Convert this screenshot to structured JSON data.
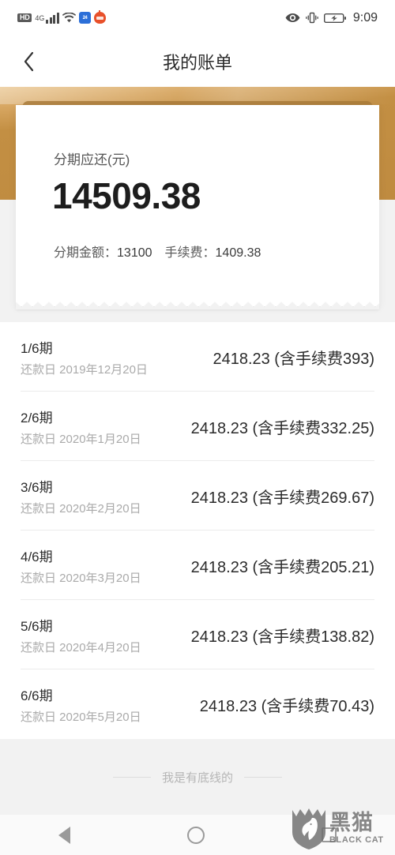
{
  "statusbar": {
    "hd_label": "HD",
    "network_label": "4G",
    "app_icon_blue_text": "24",
    "icons": [
      "hd-icon",
      "signal-icon",
      "wifi-icon",
      "app-blue-icon",
      "app-red-icon",
      "eye-comfort-icon",
      "vibrate-icon",
      "battery-charging-icon"
    ],
    "time": "9:09"
  },
  "header": {
    "back_icon": "chevron-left-icon",
    "title": "我的账单"
  },
  "summary_card": {
    "label": "分期应还(元)",
    "amount": "14509.38",
    "principal_label": "分期金额：",
    "principal_value": "13100",
    "fee_label": "手续费：",
    "fee_value": "1409.38"
  },
  "installments": [
    {
      "period": "1/6期",
      "due": "还款日 2019年12月20日",
      "amount": "2418.23 (含手续费393)"
    },
    {
      "period": "2/6期",
      "due": "还款日 2020年1月20日",
      "amount": "2418.23 (含手续费332.25)"
    },
    {
      "period": "3/6期",
      "due": "还款日 2020年2月20日",
      "amount": "2418.23 (含手续费269.67)"
    },
    {
      "period": "4/6期",
      "due": "还款日 2020年3月20日",
      "amount": "2418.23 (含手续费205.21)"
    },
    {
      "period": "5/6期",
      "due": "还款日 2020年4月20日",
      "amount": "2418.23 (含手续费138.82)"
    },
    {
      "period": "6/6期",
      "due": "还款日 2020年5月20日",
      "amount": "2418.23 (含手续费70.43)"
    }
  ],
  "footer": {
    "end_of_list_text": "我是有底线的"
  },
  "navbar": {
    "back_icon": "triangle-back-icon",
    "home_icon": "circle-home-icon",
    "recents_icon": "square-recents-icon"
  },
  "watermark": {
    "shield_icon": "black-cat-shield-icon",
    "cn_text": "黑猫",
    "en_text": "BLACK CAT"
  },
  "colors": {
    "gold_band": "#c38f43",
    "gold_rail": "#a87a38",
    "page_bg": "#f2f2f2",
    "card_bg": "#ffffff",
    "primary_text": "#2b2b2b",
    "muted_text": "#aaaaaa"
  }
}
